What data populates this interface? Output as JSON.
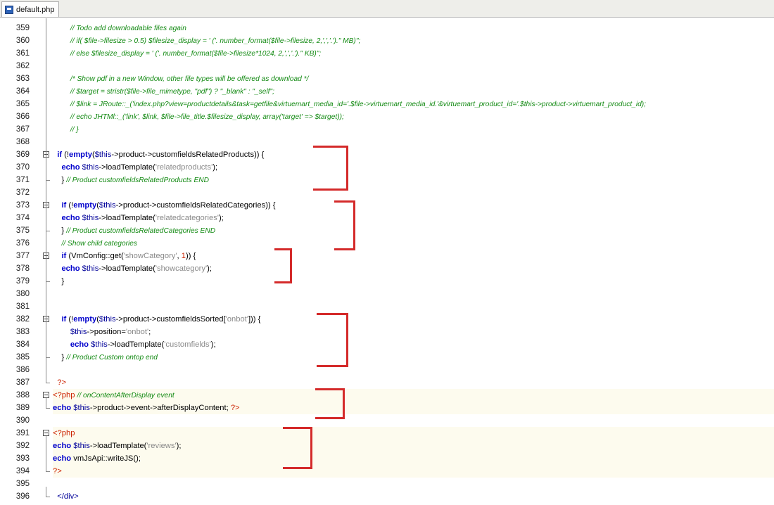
{
  "tab": {
    "filename": "default.php",
    "icon": "php-file-icon"
  },
  "colors": {
    "comment": "#138a13",
    "keyword": "#0000cc",
    "string": "#8a8a8a",
    "php_tag": "#cc2200",
    "annotation": "#d42a2a"
  },
  "lines": [
    {
      "n": "359",
      "hl": false,
      "tokens": [
        [
          "pl",
          "        "
        ],
        [
          "cm",
          "// Todo add downloadable files again"
        ]
      ]
    },
    {
      "n": "360",
      "hl": false,
      "tokens": [
        [
          "pl",
          "        "
        ],
        [
          "cm",
          "// if( $file->filesize > 0.5) $filesize_display = ' ('. number_format($file->filesize, 2,',','.').\" MB)\";"
        ]
      ]
    },
    {
      "n": "361",
      "hl": false,
      "tokens": [
        [
          "pl",
          "        "
        ],
        [
          "cm",
          "// else $filesize_display = ' ('. number_format($file->filesize*1024, 2,',','.').\" KB)\";"
        ]
      ]
    },
    {
      "n": "362",
      "hl": false,
      "tokens": []
    },
    {
      "n": "363",
      "hl": false,
      "tokens": [
        [
          "pl",
          "        "
        ],
        [
          "cm",
          "/* Show pdf in a new Window, other file types will be offered as download */"
        ]
      ]
    },
    {
      "n": "364",
      "hl": false,
      "tokens": [
        [
          "pl",
          "        "
        ],
        [
          "cm",
          "// $target = stristr($file->file_mimetype, \"pdf\") ? \"_blank\" : \"_self\";"
        ]
      ]
    },
    {
      "n": "365",
      "hl": false,
      "tokens": [
        [
          "pl",
          "        "
        ],
        [
          "cm",
          "// $link = JRoute::_('index.php?view=productdetails&task=getfile&virtuemart_media_id='.$file->virtuemart_media_id.'&virtuemart_product_id='.$this->product->virtuemart_product_id);"
        ]
      ]
    },
    {
      "n": "366",
      "hl": false,
      "tokens": [
        [
          "pl",
          "        "
        ],
        [
          "cm",
          "// echo JHTMl::_('link', $link, $file->file_title.$filesize_display, array('target' => $target));"
        ]
      ]
    },
    {
      "n": "367",
      "hl": false,
      "tokens": [
        [
          "pl",
          "        "
        ],
        [
          "cm",
          "// }"
        ]
      ]
    },
    {
      "n": "368",
      "hl": false,
      "tokens": []
    },
    {
      "n": "369",
      "hl": false,
      "tokens": [
        [
          "pl",
          "  "
        ],
        [
          "kw",
          "if"
        ],
        [
          "pl",
          " (!"
        ],
        [
          "kw",
          "empty"
        ],
        [
          "pl",
          "("
        ],
        [
          "var",
          "$this"
        ],
        [
          "pl",
          "->product->customfieldsRelatedProducts)) {"
        ]
      ]
    },
    {
      "n": "370",
      "hl": false,
      "tokens": [
        [
          "pl",
          "    "
        ],
        [
          "kw",
          "echo"
        ],
        [
          "pl",
          " "
        ],
        [
          "var",
          "$this"
        ],
        [
          "pl",
          "->loadTemplate("
        ],
        [
          "str",
          "'relatedproducts'"
        ],
        [
          "pl",
          ");"
        ]
      ]
    },
    {
      "n": "371",
      "hl": false,
      "tokens": [
        [
          "pl",
          "    } "
        ],
        [
          "cm",
          "// Product customfieldsRelatedProducts END"
        ]
      ]
    },
    {
      "n": "372",
      "hl": false,
      "tokens": []
    },
    {
      "n": "373",
      "hl": false,
      "tokens": [
        [
          "pl",
          "    "
        ],
        [
          "kw",
          "if"
        ],
        [
          "pl",
          " (!"
        ],
        [
          "kw",
          "empty"
        ],
        [
          "pl",
          "("
        ],
        [
          "var",
          "$this"
        ],
        [
          "pl",
          "->product->customfieldsRelatedCategories)) {"
        ]
      ]
    },
    {
      "n": "374",
      "hl": false,
      "tokens": [
        [
          "pl",
          "    "
        ],
        [
          "kw",
          "echo"
        ],
        [
          "pl",
          " "
        ],
        [
          "var",
          "$this"
        ],
        [
          "pl",
          "->loadTemplate("
        ],
        [
          "str",
          "'relatedcategories'"
        ],
        [
          "pl",
          ");"
        ]
      ]
    },
    {
      "n": "375",
      "hl": false,
      "tokens": [
        [
          "pl",
          "    } "
        ],
        [
          "cm",
          "// Product customfieldsRelatedCategories END"
        ]
      ]
    },
    {
      "n": "376",
      "hl": false,
      "tokens": [
        [
          "pl",
          "    "
        ],
        [
          "cm",
          "// Show child categories"
        ]
      ]
    },
    {
      "n": "377",
      "hl": false,
      "tokens": [
        [
          "pl",
          "    "
        ],
        [
          "kw",
          "if"
        ],
        [
          "pl",
          " (VmConfig::get("
        ],
        [
          "str",
          "'showCategory'"
        ],
        [
          "pl",
          ", "
        ],
        [
          "num",
          "1"
        ],
        [
          "pl",
          ")) {"
        ]
      ]
    },
    {
      "n": "378",
      "hl": false,
      "tokens": [
        [
          "pl",
          "    "
        ],
        [
          "kw",
          "echo"
        ],
        [
          "pl",
          " "
        ],
        [
          "var",
          "$this"
        ],
        [
          "pl",
          "->loadTemplate("
        ],
        [
          "str",
          "'showcategory'"
        ],
        [
          "pl",
          ");"
        ]
      ]
    },
    {
      "n": "379",
      "hl": false,
      "tokens": [
        [
          "pl",
          "    }"
        ]
      ]
    },
    {
      "n": "380",
      "hl": false,
      "tokens": []
    },
    {
      "n": "381",
      "hl": false,
      "tokens": []
    },
    {
      "n": "382",
      "hl": false,
      "tokens": [
        [
          "pl",
          "    "
        ],
        [
          "kw",
          "if"
        ],
        [
          "pl",
          " (!"
        ],
        [
          "kw",
          "empty"
        ],
        [
          "pl",
          "("
        ],
        [
          "var",
          "$this"
        ],
        [
          "pl",
          "->product->customfieldsSorted["
        ],
        [
          "str",
          "'onbot'"
        ],
        [
          "pl",
          "])) {"
        ]
      ]
    },
    {
      "n": "383",
      "hl": false,
      "tokens": [
        [
          "pl",
          "        "
        ],
        [
          "var",
          "$this"
        ],
        [
          "pl",
          "->position="
        ],
        [
          "str",
          "'onbot'"
        ],
        [
          "pl",
          ";"
        ]
      ]
    },
    {
      "n": "384",
      "hl": false,
      "tokens": [
        [
          "pl",
          "        "
        ],
        [
          "kw",
          "echo"
        ],
        [
          "pl",
          " "
        ],
        [
          "var",
          "$this"
        ],
        [
          "pl",
          "->loadTemplate("
        ],
        [
          "str",
          "'customfields'"
        ],
        [
          "pl",
          ");"
        ]
      ]
    },
    {
      "n": "385",
      "hl": false,
      "tokens": [
        [
          "pl",
          "    } "
        ],
        [
          "cm",
          "// Product Custom ontop end"
        ]
      ]
    },
    {
      "n": "386",
      "hl": false,
      "tokens": []
    },
    {
      "n": "387",
      "hl": false,
      "tokens": [
        [
          "pl",
          "  "
        ],
        [
          "php",
          "?>"
        ]
      ]
    },
    {
      "n": "388",
      "hl": true,
      "tokens": [
        [
          "php",
          "<?php"
        ],
        [
          "pl",
          " "
        ],
        [
          "cm",
          "// onContentAfterDisplay event"
        ]
      ]
    },
    {
      "n": "389",
      "hl": true,
      "tokens": [
        [
          "kw",
          "echo"
        ],
        [
          "pl",
          " "
        ],
        [
          "var",
          "$this"
        ],
        [
          "pl",
          "->product->event->afterDisplayContent; "
        ],
        [
          "php",
          "?>"
        ]
      ]
    },
    {
      "n": "390",
      "hl": false,
      "tokens": []
    },
    {
      "n": "391",
      "hl": true,
      "tokens": [
        [
          "php",
          "<?php"
        ]
      ]
    },
    {
      "n": "392",
      "hl": true,
      "tokens": [
        [
          "kw",
          "echo"
        ],
        [
          "pl",
          " "
        ],
        [
          "var",
          "$this"
        ],
        [
          "pl",
          "->loadTemplate("
        ],
        [
          "str",
          "'reviews'"
        ],
        [
          "pl",
          ");"
        ]
      ]
    },
    {
      "n": "393",
      "hl": true,
      "tokens": [
        [
          "kw",
          "echo"
        ],
        [
          "pl",
          " vmJsApi::writeJS();"
        ]
      ]
    },
    {
      "n": "394",
      "hl": true,
      "tokens": [
        [
          "php",
          "?>"
        ]
      ]
    },
    {
      "n": "395",
      "hl": false,
      "tokens": []
    },
    {
      "n": "396",
      "hl": false,
      "tokens": [
        [
          "pl",
          "  "
        ],
        [
          "var",
          "</div>"
        ]
      ]
    }
  ]
}
